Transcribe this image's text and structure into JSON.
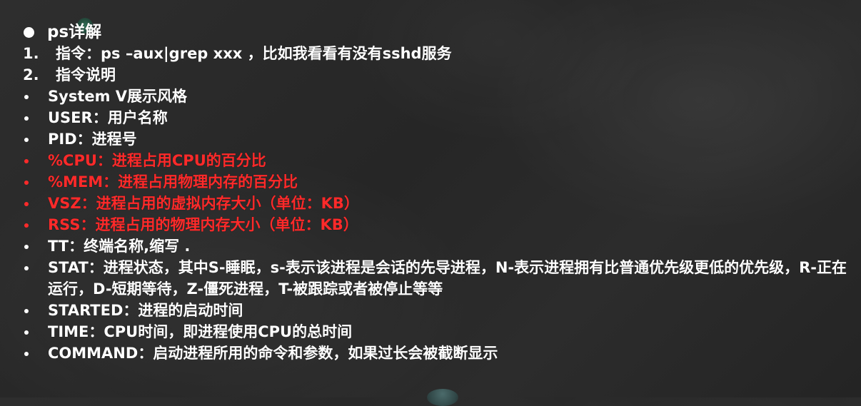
{
  "colors": {
    "normal_text": "#ffffff",
    "highlight_text": "#ff2a2a",
    "background": "#292929"
  },
  "heading": {
    "prefix": "ps",
    "title": "详解"
  },
  "numbered": [
    {
      "number": "1.",
      "text": "指令：ps –aux|grep xxx ，比如我看看有没有sshd服务"
    },
    {
      "number": "2.",
      "text": "指令说明"
    }
  ],
  "bullets": [
    {
      "text": "System V展示风格",
      "highlight": false
    },
    {
      "text": "USER：用户名称",
      "highlight": false
    },
    {
      "text": "PID：进程号",
      "highlight": false
    },
    {
      "text": "%CPU：进程占用CPU的百分比",
      "highlight": true
    },
    {
      "text": "%MEM：进程占用物理内存的百分比",
      "highlight": true
    },
    {
      "text": "VSZ：进程占用的虚拟内存大小（单位：KB）",
      "highlight": true
    },
    {
      "text": "RSS：进程占用的物理内存大小（单位：KB）",
      "highlight": true
    },
    {
      "text": "TT：终端名称,缩写 .",
      "highlight": false
    },
    {
      "text": "STAT：进程状态，其中S-睡眠，s-表示该进程是会话的先导进程，N-表示进程拥有比普通优先级更低的优先级，R-正在运行，D-短期等待，Z-僵死进程，T-被跟踪或者被停止等等",
      "highlight": false
    },
    {
      "text": "STARTED：进程的启动时间",
      "highlight": false
    },
    {
      "text": "TIME：CPU时间，即进程使用CPU的总时间",
      "highlight": false
    },
    {
      "text": "COMMAND：启动进程所用的命令和参数，如果过长会被截断显示",
      "highlight": false
    }
  ]
}
